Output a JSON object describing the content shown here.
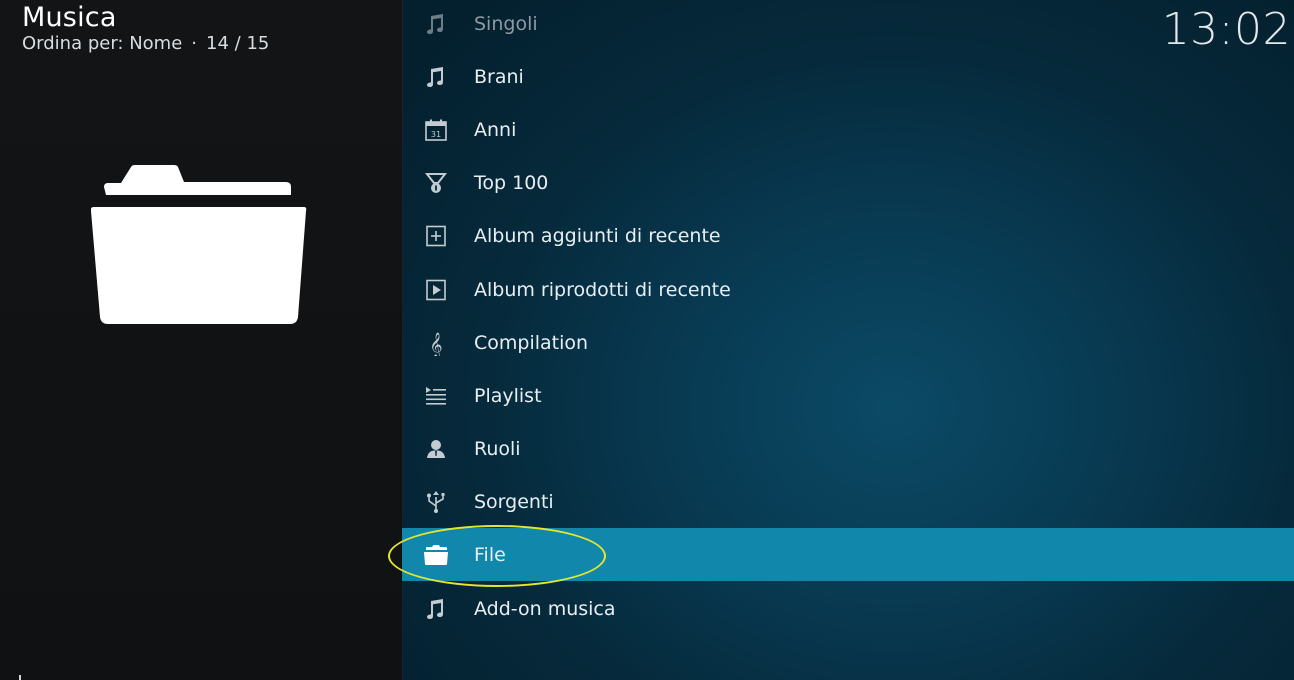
{
  "header": {
    "title": "Musica",
    "sort_label": "Ordina per: Nome",
    "separator": "·",
    "position": "14 / 15"
  },
  "clock": "13:02",
  "preview": {
    "icon": "folder-icon"
  },
  "menu": {
    "items": [
      {
        "label": "Singoli",
        "icon": "music-note-icon",
        "state": "dim"
      },
      {
        "label": "Brani",
        "icon": "music-note-icon",
        "state": "normal"
      },
      {
        "label": "Anni",
        "icon": "calendar-icon",
        "state": "normal"
      },
      {
        "label": "Top 100",
        "icon": "medal-icon",
        "state": "normal"
      },
      {
        "label": "Album aggiunti di recente",
        "icon": "plus-box-icon",
        "state": "normal"
      },
      {
        "label": "Album riprodotti di recente",
        "icon": "play-box-icon",
        "state": "normal"
      },
      {
        "label": "Compilation",
        "icon": "treble-clef-icon",
        "state": "normal"
      },
      {
        "label": "Playlist",
        "icon": "playlist-icon",
        "state": "normal"
      },
      {
        "label": "Ruoli",
        "icon": "person-icon",
        "state": "normal"
      },
      {
        "label": "Sorgenti",
        "icon": "usb-icon",
        "state": "normal"
      },
      {
        "label": "File",
        "icon": "folder-icon",
        "state": "selected"
      },
      {
        "label": "Add-on musica",
        "icon": "music-note-icon",
        "state": "normal"
      }
    ]
  },
  "colors": {
    "selected_row": "#1287ac",
    "highlight_ring": "#e6e62c",
    "left_pane": "#121416",
    "right_pane": "#083a52"
  }
}
